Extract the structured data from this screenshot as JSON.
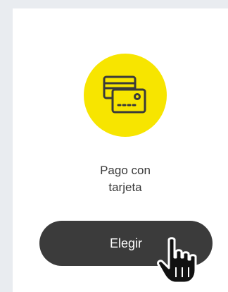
{
  "payment_option": {
    "title_line1": "Pago con",
    "title_line2": "tarjeta",
    "choose_label": "Elegir",
    "icon": "credit-cards-icon",
    "icon_background": "#f7e500",
    "button_color": "#3b3b3b"
  },
  "cursor": {
    "icon": "hand-pointer-icon"
  }
}
